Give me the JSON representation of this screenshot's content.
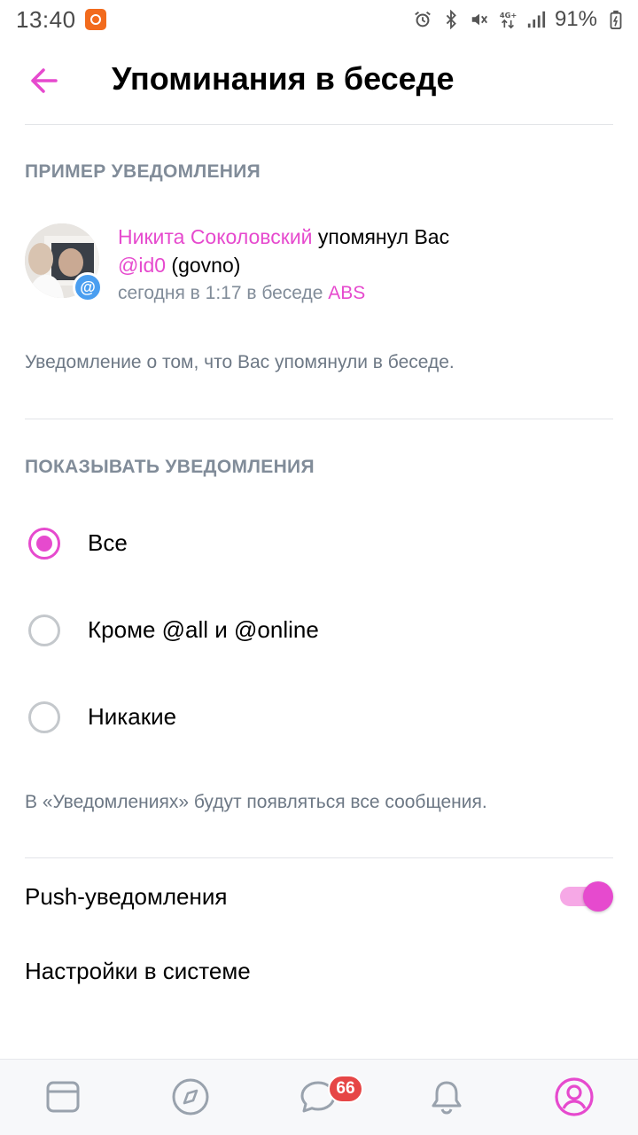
{
  "status_bar": {
    "time": "13:40",
    "battery_percent": "91%",
    "icons": [
      "app-notification-icon",
      "alarm-icon",
      "bluetooth-icon",
      "mute-icon",
      "network-4g-icon",
      "signal-icon",
      "battery-icon"
    ]
  },
  "header": {
    "title": "Упоминания в беседе",
    "back_icon": "arrow-left-icon"
  },
  "example": {
    "section_title": "ПРИМЕР УВЕДОМЛЕНИЯ",
    "author": "Никита Соколовский",
    "action": " упомянул Вас",
    "mention": "@id0",
    "mention_suffix": " (govno)",
    "time_prefix": "сегодня в 1:17 в беседе ",
    "chat_name": "ABS",
    "badge_symbol": "@",
    "description": "Уведомление о том, что Вас упомянули в беседе."
  },
  "show_notifications": {
    "section_title": "ПОКАЗЫВАТЬ УВЕДОМЛЕНИЯ",
    "options": [
      {
        "label": "Все",
        "selected": true
      },
      {
        "label": "Кроме @all и @online",
        "selected": false
      },
      {
        "label": "Никакие",
        "selected": false
      }
    ],
    "hint": "В «Уведомлениях» будут появляться все сообщения."
  },
  "settings": {
    "push_label": "Push-уведомления",
    "push_enabled": true,
    "system_label": "Настройки в системе"
  },
  "bottom_nav": {
    "items": [
      "news-icon",
      "discover-icon",
      "messages-icon",
      "notifications-icon",
      "profile-icon"
    ],
    "messages_badge": "66"
  },
  "colors": {
    "accent": "#e64ace",
    "secondary_text": "#818c99",
    "badge": "#e64646"
  }
}
